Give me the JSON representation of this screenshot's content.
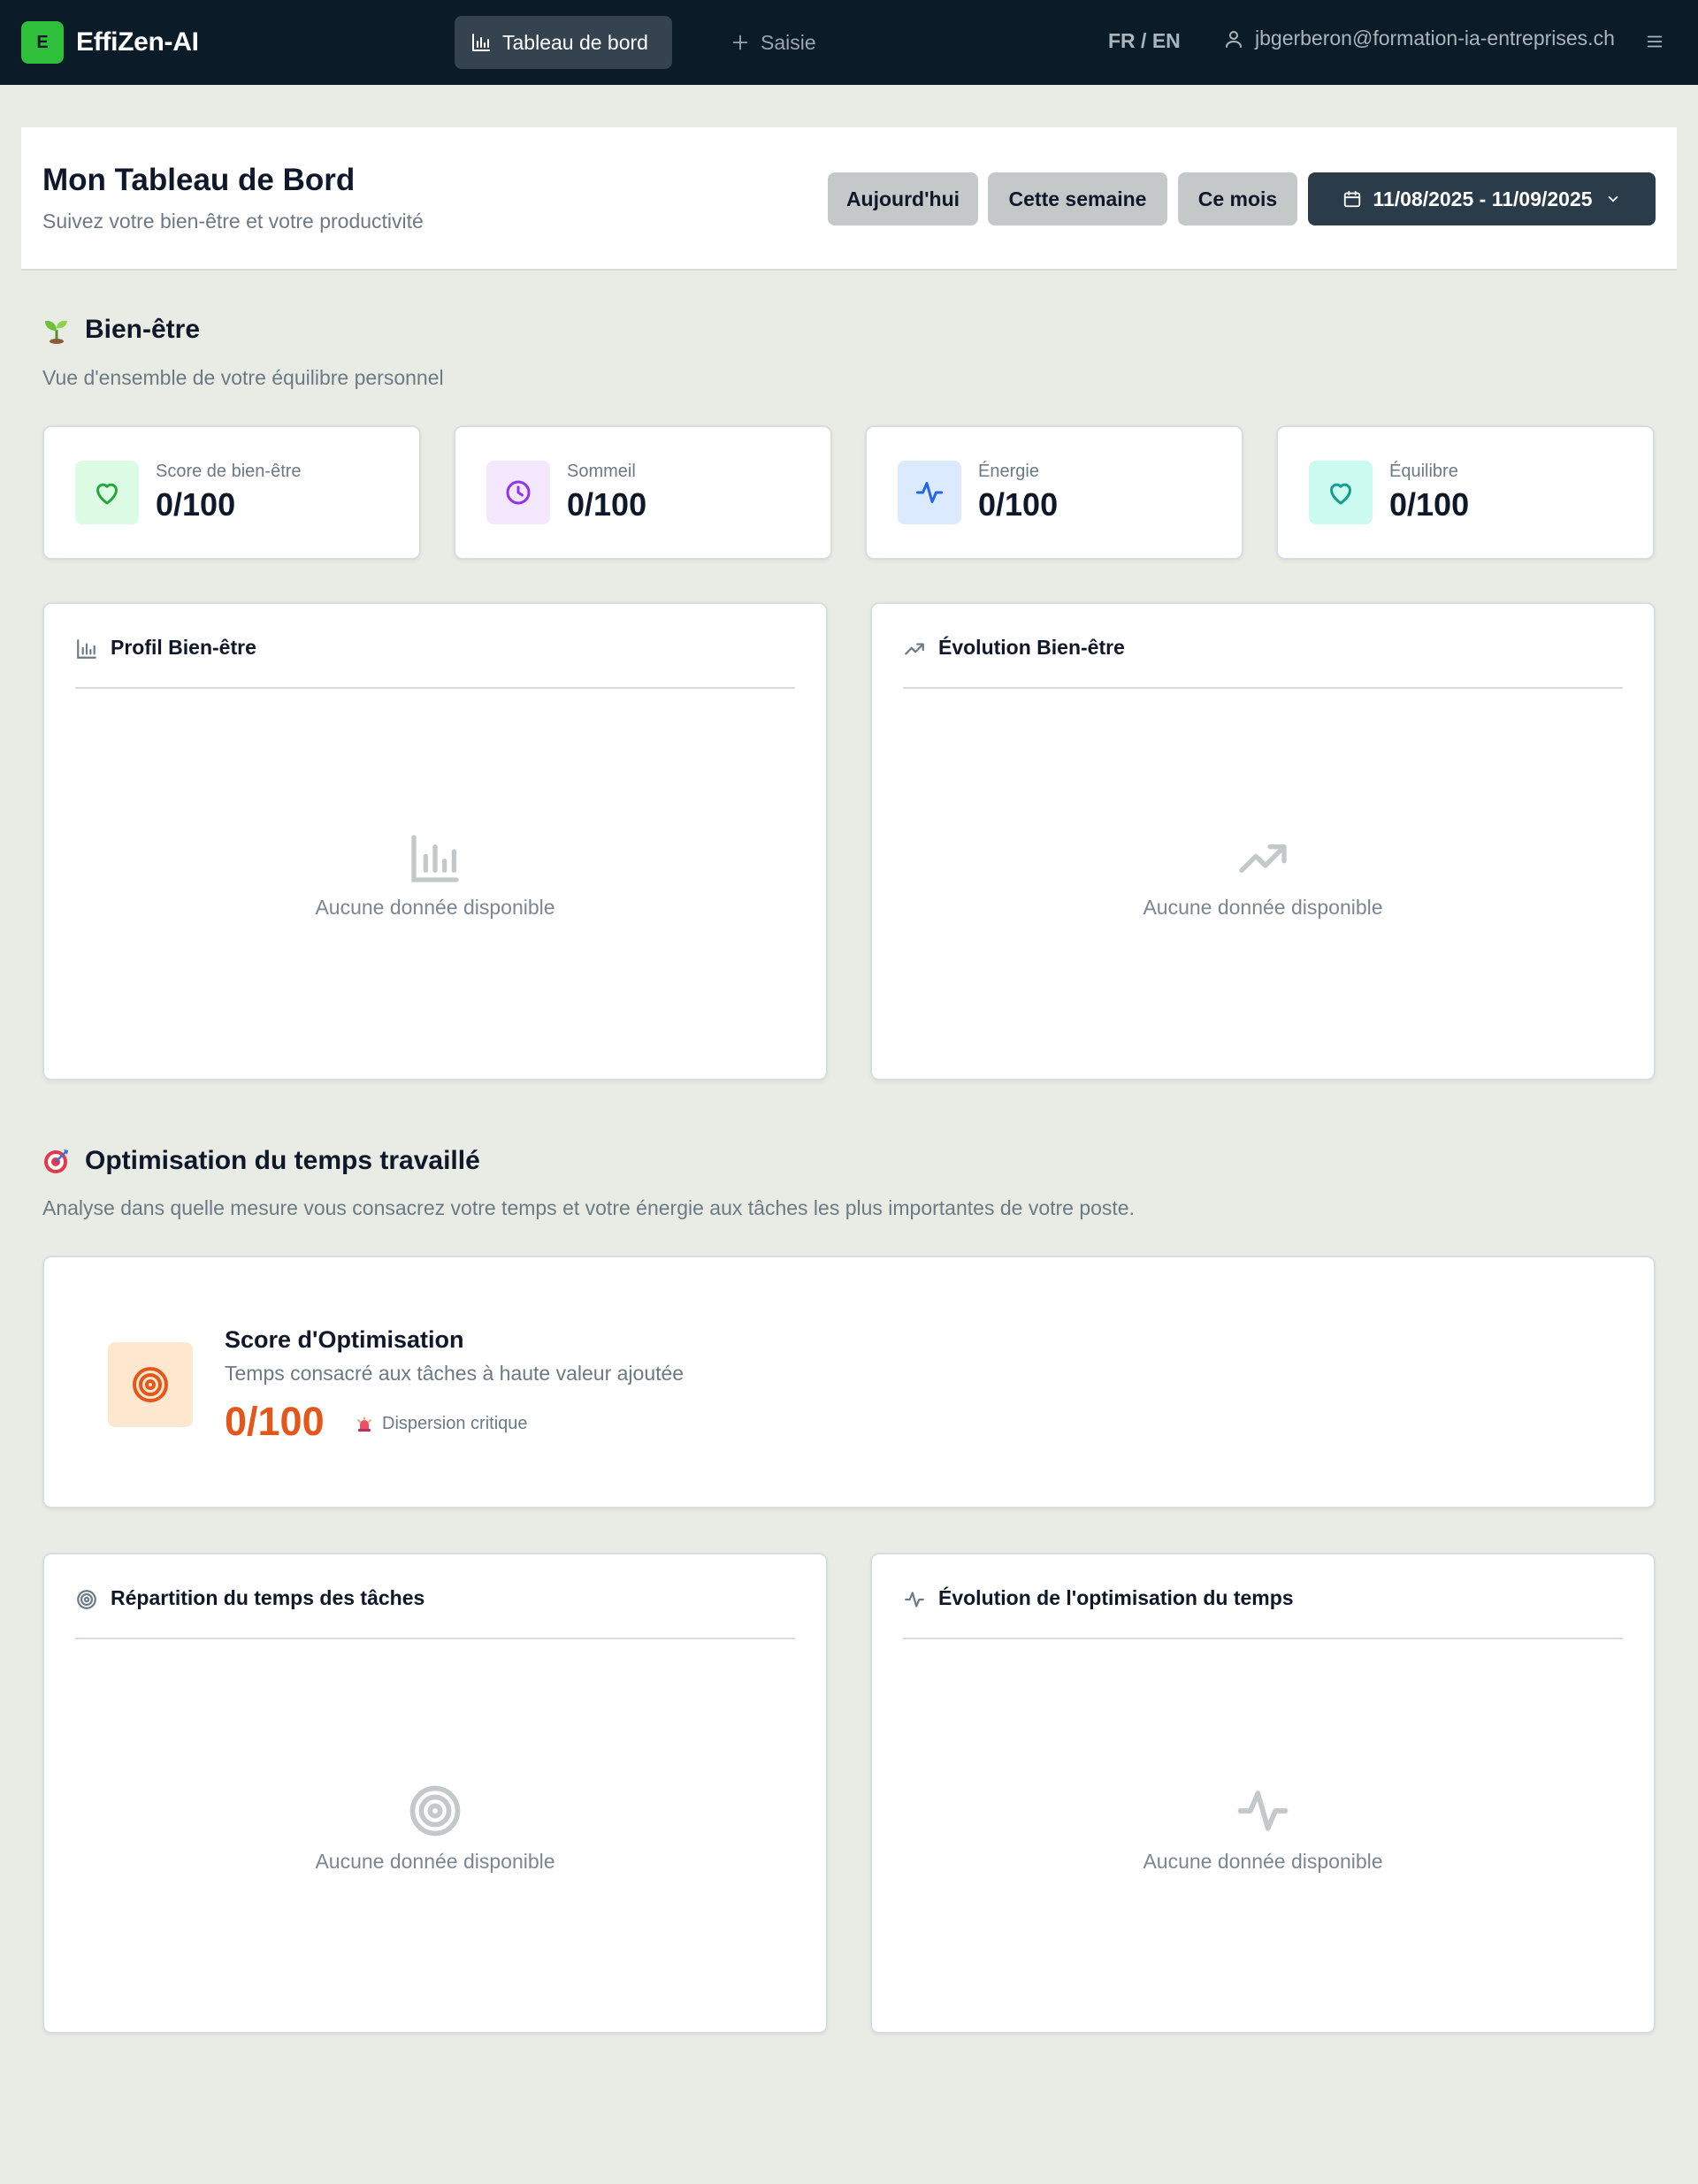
{
  "app": {
    "logo_letter": "E",
    "name": "EffiZen-AI"
  },
  "nav": {
    "tabs": [
      {
        "label": "Tableau de bord",
        "icon": "bar-chart-icon",
        "active": true
      },
      {
        "label": "Saisie",
        "icon": "plus-icon",
        "active": false
      }
    ],
    "language": "FR / EN",
    "user_email": "jbgerberon@formation-ia-entreprises.ch",
    "menu_icon": "hamburger-menu-icon"
  },
  "header": {
    "title": "Mon Tableau de Bord",
    "subtitle": "Suivez votre bien-être et votre productivité",
    "range_buttons": [
      "Aujourd'hui",
      "Cette semaine",
      "Ce mois"
    ],
    "date_range": "11/08/2025 - 11/09/2025"
  },
  "wellbeing": {
    "title": "Bien-être",
    "subtitle": "Vue d'ensemble de votre équilibre personnel",
    "stats": [
      {
        "label": "Score de bien-être",
        "value": "0/100",
        "icon": "heart-icon",
        "color": "#22a83a",
        "bg": "#dcfce5"
      },
      {
        "label": "Sommeil",
        "value": "0/100",
        "icon": "clock-icon",
        "color": "#9333ea",
        "bg": "#f3e8ff"
      },
      {
        "label": "Énergie",
        "value": "0/100",
        "icon": "activity-icon",
        "color": "#2563eb",
        "bg": "#dbeafe"
      },
      {
        "label": "Équilibre",
        "value": "0/100",
        "icon": "heart-icon",
        "color": "#0f9f8c",
        "bg": "#ccfbf1"
      }
    ],
    "charts": [
      {
        "title": "Profil Bien-être",
        "icon": "bar-chart-icon",
        "empty_text": "Aucune donnée disponible"
      },
      {
        "title": "Évolution Bien-être",
        "icon": "trending-up-icon",
        "empty_text": "Aucune donnée disponible"
      }
    ]
  },
  "optimization": {
    "title": "Optimisation du temps travaillé",
    "subtitle": "Analyse dans quelle mesure vous consacrez votre temps et votre énergie aux tâches les plus importantes de votre poste.",
    "score_card": {
      "title": "Score d'Optimisation",
      "description": "Temps consacré aux tâches à haute valeur ajoutée",
      "score": "0/100",
      "status": "Dispersion critique",
      "score_color": "#e4571b"
    },
    "charts": [
      {
        "title": "Répartition du temps des tâches",
        "icon": "target-icon",
        "empty_text": "Aucune donnée disponible"
      },
      {
        "title": "Évolution de l'optimisation du temps",
        "icon": "activity-icon",
        "empty_text": "Aucune donnée disponible"
      }
    ]
  }
}
